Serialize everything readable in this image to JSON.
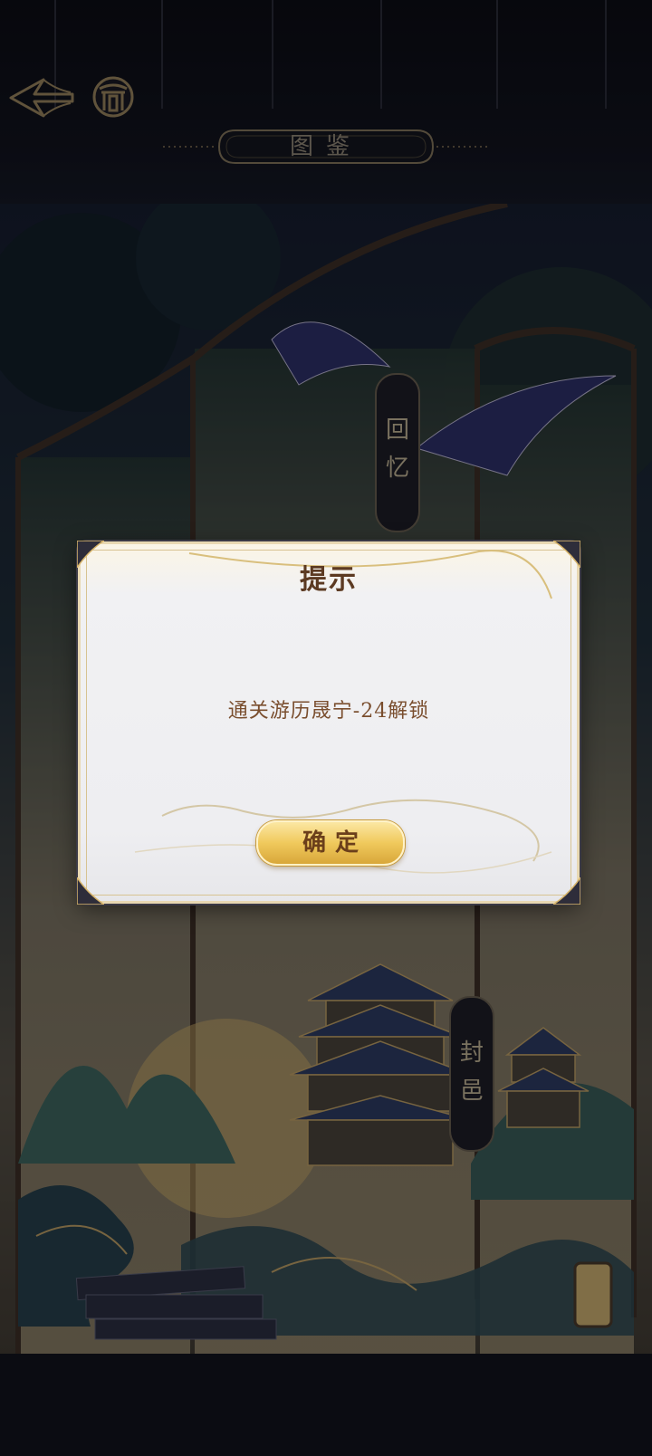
{
  "header": {
    "title": "图鉴",
    "back_icon": "swallow-arrow-back-icon",
    "home_icon": "gate-home-icon"
  },
  "scene": {
    "tags": [
      "回忆",
      "封邑"
    ],
    "tag_chars": {
      "memory": [
        "回",
        "忆"
      ],
      "fief": [
        "封",
        "邑"
      ]
    }
  },
  "dialog": {
    "title": "提示",
    "message": "通关游历晟宁-24解锁",
    "confirm_label": "确定"
  },
  "colors": {
    "gold": "#d7b46a",
    "dialog_text": "#7a4e2e",
    "title_text": "#5c3a22",
    "button_gold": "#f0c95c"
  }
}
